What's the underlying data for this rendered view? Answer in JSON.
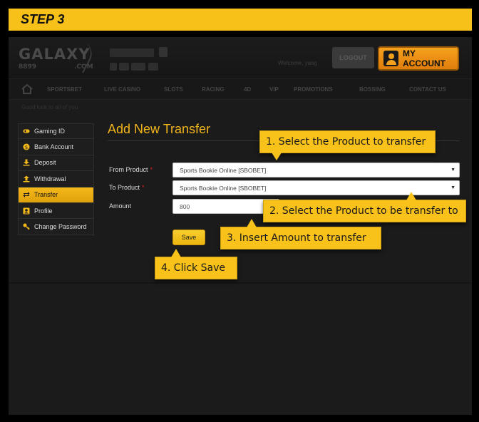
{
  "step_label": "STEP 3",
  "header": {
    "logo_main": "GALAXY",
    "logo_sub": "8899",
    "logo_com": ".COM",
    "welcome_text": "Welcome, yang",
    "logout_label": "LOGOUT",
    "my_account_label": "MY ACCOUNT"
  },
  "nav": {
    "items": [
      "SPORTSBET",
      "LIVE CASINO",
      "SLOTS",
      "RACING",
      "4D",
      "VIP",
      "PROMOTIONS",
      "BOSSING",
      "CONTACT US"
    ]
  },
  "tagline": "Good luck to all of you",
  "sidebar": {
    "items": [
      {
        "label": "Gaming ID"
      },
      {
        "label": "Bank Account"
      },
      {
        "label": "Deposit"
      },
      {
        "label": "Withdrawal"
      },
      {
        "label": "Transfer"
      },
      {
        "label": "Profile"
      },
      {
        "label": "Change Password"
      }
    ],
    "active_index": 4
  },
  "form": {
    "title": "Add New Transfer",
    "from_label": "From Product",
    "from_value": "Sports Bookie Online [SBOBET]",
    "to_label": "To Product",
    "to_value": "Sports Bookie Online [SBOBET]",
    "amount_label": "Amount",
    "amount_value": "800",
    "required_mark": "*",
    "save_label": "Save"
  },
  "callouts": {
    "c1": "1. Select the Product to transfer",
    "c2": "2. Select the Product to be transfer to",
    "c3": "3. Insert Amount to transfer",
    "c4": "4. Click Save"
  },
  "colors": {
    "accent": "#f8c21b",
    "orange": "#f0921a",
    "background": "#1b1b1b"
  }
}
